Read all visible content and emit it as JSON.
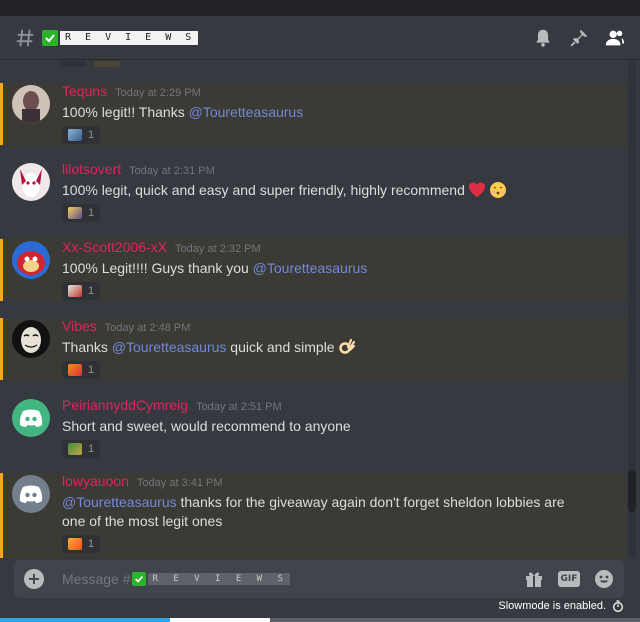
{
  "channel": {
    "name": "R E V I E W S",
    "header_icons": [
      "bell-icon",
      "pin-icon",
      "members-icon"
    ]
  },
  "messages": [
    {
      "author": "Tequns",
      "time": "Today at 2:29 PM",
      "text_before": "100% legit!! Thanks ",
      "mention": "@Touretteasaurus",
      "text_after": "",
      "reaction_count": "1"
    },
    {
      "author": "lilotsovert",
      "time": "Today at 2:31 PM",
      "text_before": "100% legit, quick and easy and super friendly, highly recommend",
      "mention": "",
      "text_after": "",
      "reaction_count": "1"
    },
    {
      "author": "Xx-Scott2006-xX",
      "time": "Today at 2:32 PM",
      "text_before": "100% Legit!!!! Guys thank you ",
      "mention": "@Touretteasaurus",
      "text_after": "",
      "reaction_count": "1"
    },
    {
      "author": "Vibes",
      "time": "Today at 2:48 PM",
      "text_before": "Thanks ",
      "mention": "@Touretteasaurus",
      "text_after": " quick and simple",
      "reaction_count": "1"
    },
    {
      "author": "PeiriannyddCymreig",
      "time": "Today at 2:51 PM",
      "text_before": "Short and sweet, would recommend to anyone",
      "mention": "",
      "text_after": "",
      "reaction_count": "1"
    },
    {
      "author": "lowyauoon",
      "time": "Today at 3:41 PM",
      "text_before": "",
      "mention": "@Touretteasaurus",
      "text_after": " thanks for the giveaway again don't forget sheldon lobbies are one of the most legit ones",
      "reaction_count": "1"
    }
  ],
  "composer": {
    "placeholder_prefix": "Message #",
    "channel_name": "R E V I E W S",
    "gif_label": "GIF"
  },
  "slowmode_text": "Slowmode is enabled.",
  "colors": {
    "author": "#e0245e",
    "mention": "#7289da",
    "highlight_border": "#faa61a",
    "background": "#36393f"
  }
}
